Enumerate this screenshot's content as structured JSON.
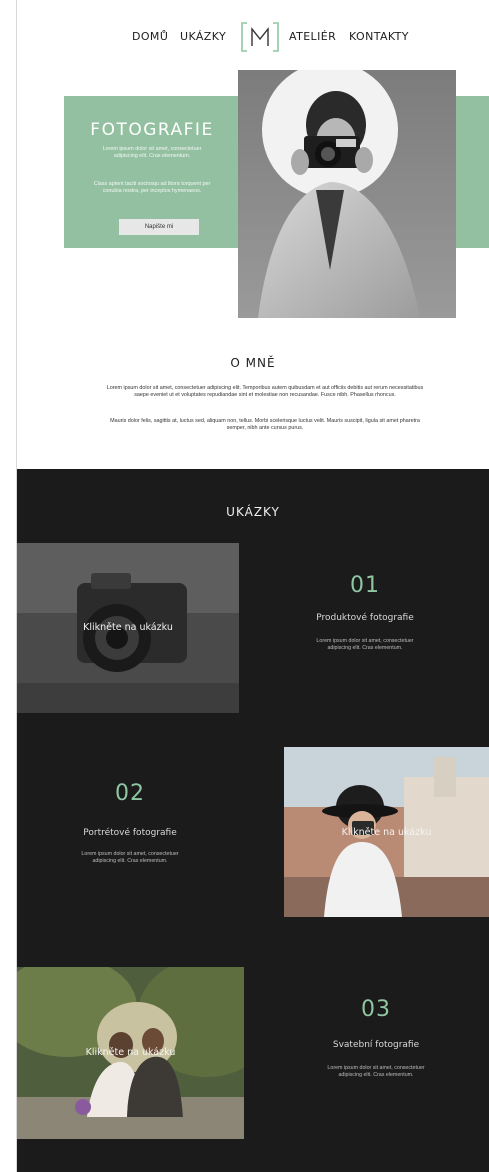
{
  "nav": {
    "items": [
      "DOMŮ",
      "UKÁZKY",
      "ATELIÉR",
      "KONTAKTY"
    ],
    "logo_letter": "M"
  },
  "hero": {
    "title": "FOTOGRAFIE",
    "paragraph1": "Lorem ipsum dolor sit amet, consectetuer adipiscing elit. Cras elementum.",
    "paragraph2": "Class aptent taciti sociosqu ad litora torquent per conubia nostra, per inceptos hymenaeos.",
    "button_label": "Napište mi"
  },
  "about": {
    "title": "O MNĚ",
    "paragraph1": "Lorem ipsum dolor sit amet, consectetuer adipiscing elit. Temporibus autem quibusdam et aut officiis debitis aut rerum necessitatibus saepe eveniet ut et voluptates repudiandae sint et molestiae non recusandae. Fusce nibh. Phasellus rhoncus.",
    "paragraph2": "Mauris dolor felis, sagittis at, luctus sed, aliquam non, tellus. Morbi scelerisque luctus velit. Mauris suscipit, ligula sit amet pharetra semper, nibh ante cursus purus."
  },
  "samples": {
    "title": "UKÁZKY",
    "items": [
      {
        "number": "01",
        "label": "Produktové fotografie",
        "text": "Lorem ipsum dolor sit amet, consectetuer adipiscing elit. Cras elementum.",
        "cta": "Klikněte na ukázku"
      },
      {
        "number": "02",
        "label": "Portrétové fotografie",
        "text": "Lorem ipsum dolor sit amet, consectetuer adipiscing elit. Cras elementum.",
        "cta": "Klikněte na ukázku"
      },
      {
        "number": "03",
        "label": "Svatební fotografie",
        "text": "Lorem ipsum dolor sit amet, consectetuer adipiscing elit. Cras elementum.",
        "cta": "Klikněte na ukázku"
      }
    ]
  },
  "colors": {
    "accent_green": "#93c0a0",
    "number_green": "#8fc6a2",
    "dark_bg": "#1b1b1b"
  }
}
